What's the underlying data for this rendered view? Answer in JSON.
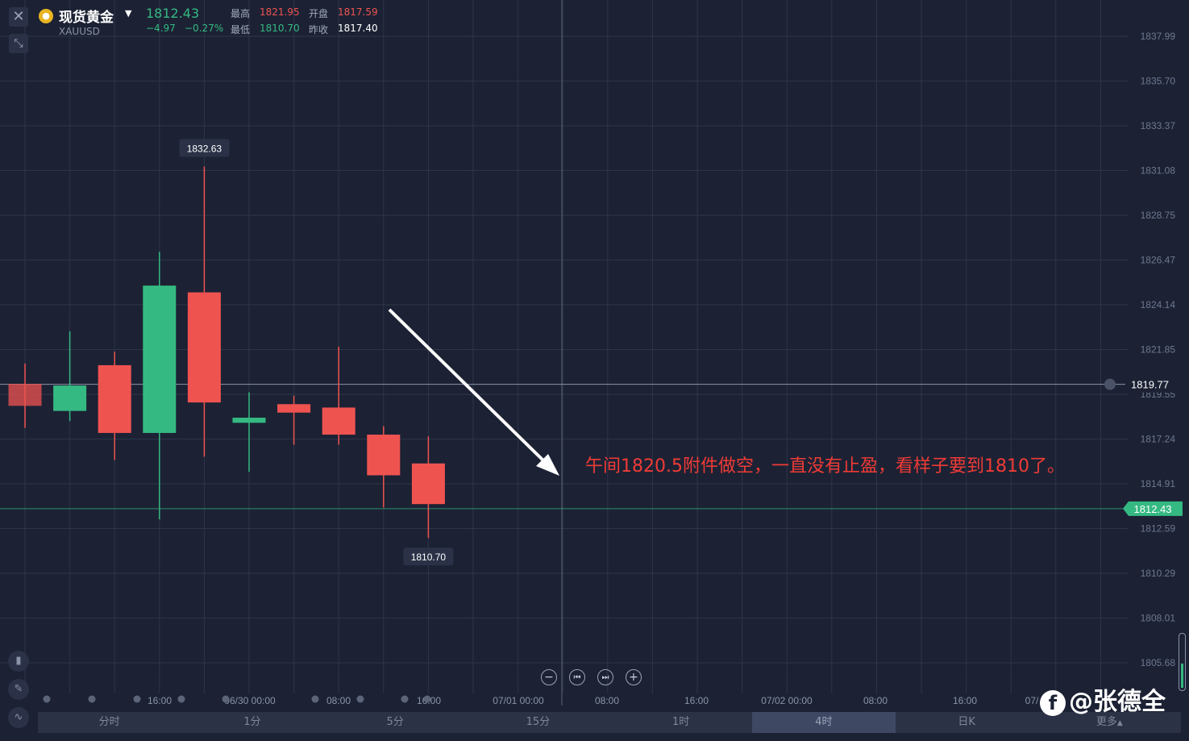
{
  "header": {
    "close_icon": "close-icon",
    "shrink_icon": "shrink-icon",
    "coin_icon": "gold-coin-icon",
    "name": "现货黄金",
    "code": "XAUUSD",
    "last": "1812.43",
    "change": "−4.97",
    "change_pct": "−0.27%",
    "high_label": "最高",
    "high": "1821.95",
    "open_label": "开盘",
    "open": "1817.59",
    "low_label": "最低",
    "low": "1810.70",
    "prev_label": "昨收",
    "prev": "1817.40"
  },
  "annotation": "午间1820.5附件做空，一直没有止盈，看样子要到1810了。",
  "watermark": "@张德全",
  "tabs": [
    {
      "label": "分时",
      "active": false
    },
    {
      "label": "1分",
      "active": false
    },
    {
      "label": "5分",
      "active": false
    },
    {
      "label": "15分",
      "active": false
    },
    {
      "label": "1时",
      "active": false
    },
    {
      "label": "4时",
      "active": true
    },
    {
      "label": "日K",
      "active": false
    },
    {
      "label": "更多",
      "active": false
    }
  ],
  "controls": {
    "zoom_out": "−",
    "prev": "⏮",
    "next": "⏭",
    "zoom_in": "+"
  },
  "colors": {
    "up": "#ef5350",
    "down": "#35b982",
    "bg": "#1c2234",
    "grid": "#2e3549",
    "arrow": "#ffffff"
  },
  "chart_data": {
    "type": "candlestick",
    "up_color": "#ef5350",
    "down_color": "#35b982",
    "ylim": [
      1803.33,
      1840.32
    ],
    "y_ticks": [
      "1837.99",
      "1835.70",
      "1833.37",
      "1831.08",
      "1828.75",
      "1826.47",
      "1824.14",
      "1821.85",
      "1819.55",
      "1817.24",
      "1814.91",
      "1812.59",
      "1810.29",
      "1808.01",
      "1805.68"
    ],
    "x_ticks": [
      "16:00",
      "06/30 00:00",
      "08:00",
      "16:00",
      "07/01 00:00",
      "08:00",
      "16:00",
      "07/02 00:00",
      "08:00",
      "16:00",
      "07/"
    ],
    "candles": [
      {
        "open": 1819.8,
        "close": 1818.5,
        "high": 1821.0,
        "low": 1817.2
      },
      {
        "open": 1818.2,
        "close": 1819.7,
        "high": 1822.9,
        "low": 1817.6
      },
      {
        "open": 1820.9,
        "close": 1816.9,
        "high": 1821.7,
        "low": 1815.3
      },
      {
        "open": 1816.9,
        "close": 1825.6,
        "high": 1827.6,
        "low": 1811.8
      },
      {
        "open": 1825.2,
        "close": 1818.7,
        "high": 1832.63,
        "low": 1815.5
      },
      {
        "open": 1817.5,
        "close": 1817.8,
        "high": 1819.3,
        "low": 1814.6
      },
      {
        "open": 1818.6,
        "close": 1818.1,
        "high": 1819.1,
        "low": 1816.2
      },
      {
        "open": 1818.4,
        "close": 1816.8,
        "high": 1822.0,
        "low": 1816.2
      },
      {
        "open": 1816.8,
        "close": 1814.4,
        "high": 1817.3,
        "low": 1812.5
      },
      {
        "open": 1815.1,
        "close": 1812.7,
        "high": 1816.7,
        "low": 1810.7
      }
    ],
    "high_marker": "1832.63",
    "low_marker": "1810.70",
    "ref_line": "1819.77",
    "last_price_line": "1812.43"
  }
}
